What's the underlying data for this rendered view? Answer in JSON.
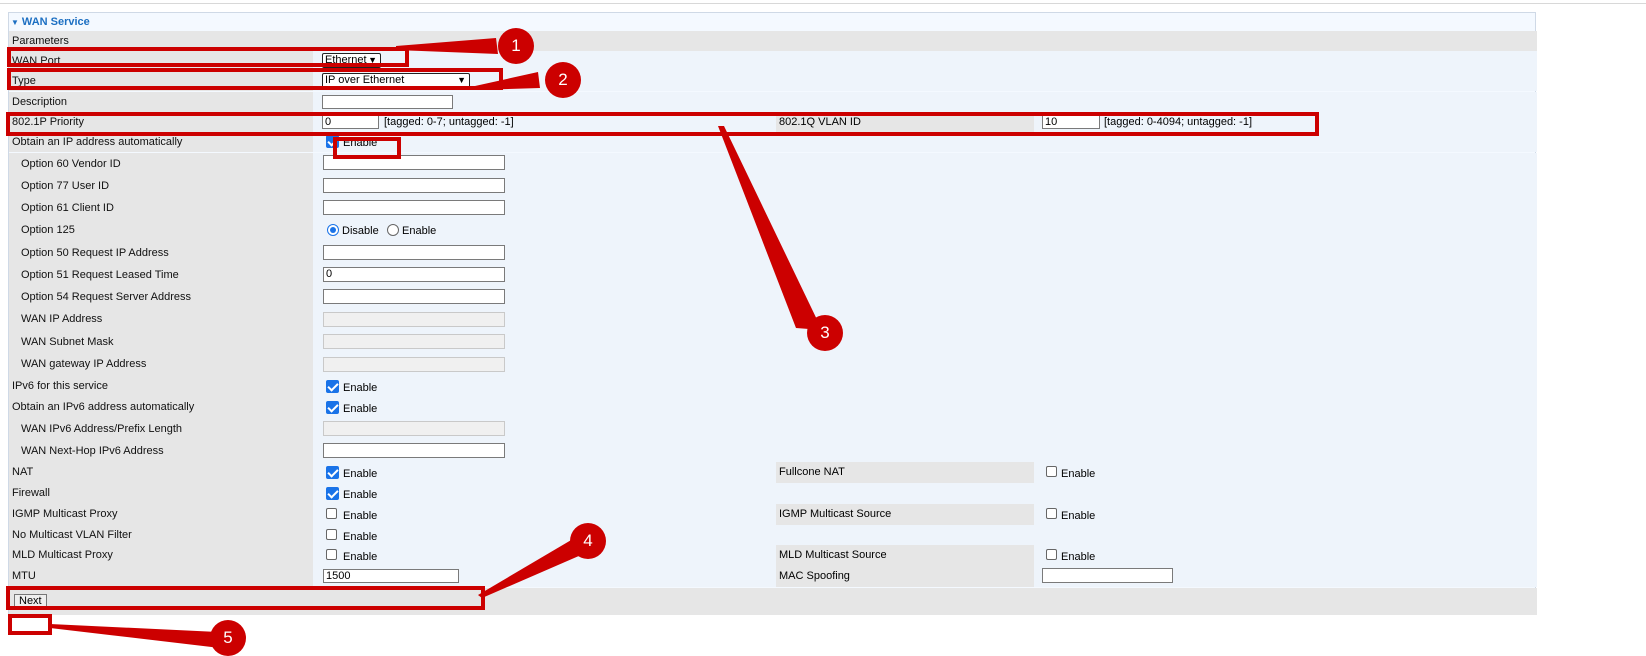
{
  "panel": {
    "title": "WAN Service",
    "section": "Parameters"
  },
  "fields": {
    "wan_port": {
      "label": "WAN Port",
      "value": "Ethernet"
    },
    "type": {
      "label": "Type",
      "value": "IP over Ethernet"
    },
    "description": {
      "label": "Description",
      "value": ""
    },
    "priority": {
      "label": "802.1P Priority",
      "value": "0",
      "hint": "[tagged: 0-7; untagged: -1]"
    },
    "vlan_id": {
      "label": "802.1Q VLAN ID",
      "value": "10",
      "hint": "[tagged: 0-4094; untagged: -1]"
    },
    "obtain_ip": {
      "label": "Obtain an IP address automatically",
      "checked": true,
      "option": "Enable"
    },
    "opt60": {
      "label": "Option 60 Vendor ID",
      "value": ""
    },
    "opt77": {
      "label": "Option 77 User ID",
      "value": ""
    },
    "opt61": {
      "label": "Option 61 Client ID",
      "value": ""
    },
    "opt125": {
      "label": "Option 125",
      "disable": "Disable",
      "enable": "Enable",
      "selected": "Disable"
    },
    "opt50": {
      "label": "Option 50 Request IP Address",
      "value": ""
    },
    "opt51": {
      "label": "Option 51 Request Leased Time",
      "value": "0"
    },
    "opt54": {
      "label": "Option 54 Request Server Address",
      "value": ""
    },
    "wan_ip": {
      "label": "WAN IP Address",
      "value": ""
    },
    "wan_mask": {
      "label": "WAN Subnet Mask",
      "value": ""
    },
    "wan_gw": {
      "label": "WAN gateway IP Address",
      "value": ""
    },
    "ipv6": {
      "label": "IPv6 for this service",
      "checked": true,
      "option": "Enable"
    },
    "obtain_ipv6": {
      "label": "Obtain an IPv6 address automatically",
      "checked": true,
      "option": "Enable"
    },
    "wan_ipv6": {
      "label": "WAN IPv6 Address/Prefix Length",
      "value": ""
    },
    "nexthop": {
      "label": "WAN Next-Hop IPv6 Address",
      "value": ""
    },
    "nat": {
      "label": "NAT",
      "checked": true,
      "option": "Enable"
    },
    "fullcone": {
      "label": "Fullcone NAT",
      "checked": false,
      "option": "Enable"
    },
    "firewall": {
      "label": "Firewall",
      "checked": true,
      "option": "Enable"
    },
    "igmp_proxy": {
      "label": "IGMP Multicast Proxy",
      "checked": false,
      "option": "Enable"
    },
    "igmp_source": {
      "label": "IGMP Multicast Source",
      "checked": false,
      "option": "Enable"
    },
    "no_vlan_filter": {
      "label": "No Multicast VLAN Filter",
      "checked": false,
      "option": "Enable"
    },
    "mld_proxy": {
      "label": "MLD Multicast Proxy",
      "checked": false,
      "option": "Enable"
    },
    "mld_source": {
      "label": "MLD Multicast Source",
      "checked": false,
      "option": "Enable"
    },
    "mtu": {
      "label": "MTU",
      "value": "1500"
    },
    "mac_spoof": {
      "label": "MAC Spoofing",
      "value": ""
    }
  },
  "footer": {
    "next": "Next"
  },
  "annotations": [
    "1",
    "2",
    "3",
    "4",
    "5"
  ],
  "colors": {
    "accent": "#1c6fc2",
    "annotation": "#cc0000",
    "label_bg": "#e6e6e6",
    "value_bg": "#eef4fb"
  }
}
